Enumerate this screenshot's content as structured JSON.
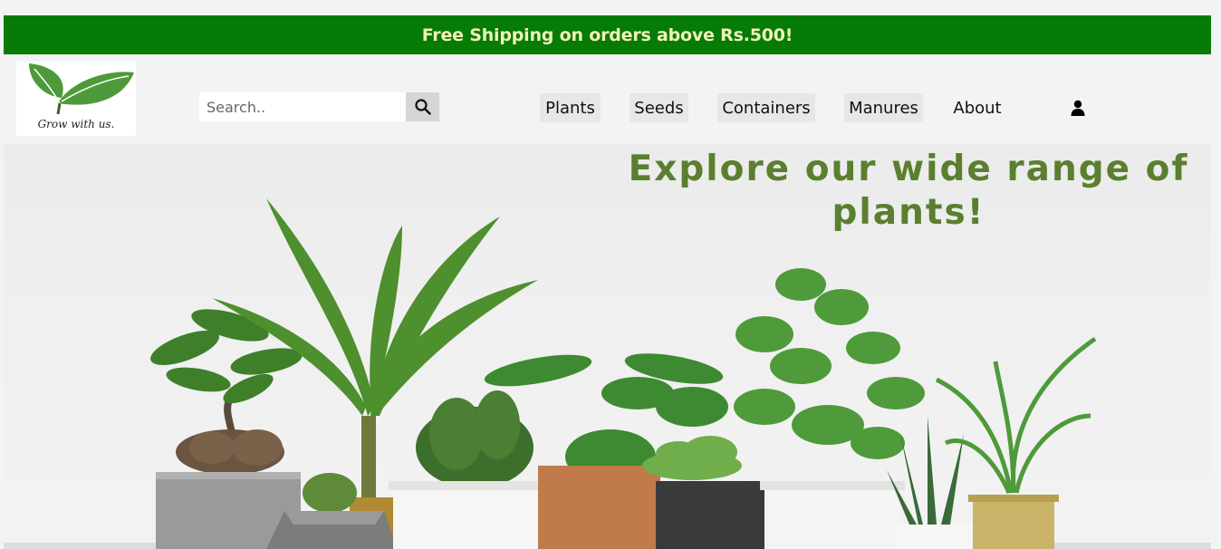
{
  "promo": {
    "text": "Free Shipping on orders above Rs.500!"
  },
  "logo": {
    "tagline": "Grow with us."
  },
  "search": {
    "placeholder": "Search.."
  },
  "nav": {
    "items": [
      {
        "label": "Plants"
      },
      {
        "label": "Seeds"
      },
      {
        "label": "Containers"
      },
      {
        "label": "Manures"
      },
      {
        "label": "About"
      }
    ]
  },
  "hero": {
    "title": "Explore our wide range of plants!"
  },
  "colors": {
    "promo_bg": "#067b06",
    "promo_text": "#f1f2b8",
    "hero_title": "#5a7f2e",
    "leaf": "#4a8a2e"
  },
  "icons": {
    "search": "search-icon",
    "user": "user-icon",
    "logo": "leaf-logo-icon"
  }
}
